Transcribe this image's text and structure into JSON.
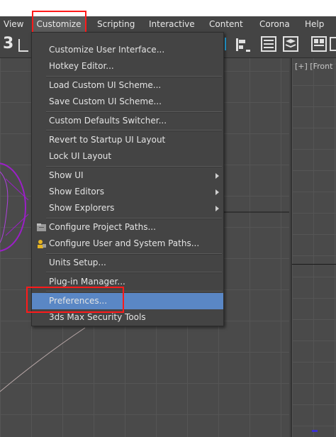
{
  "menubar": {
    "items": [
      "View",
      "Customize",
      "Scripting",
      "Interactive",
      "Content",
      "Corona",
      "Help"
    ]
  },
  "toolbar": {
    "snap_label": "3"
  },
  "viewport": {
    "right_label": "[+] [Front ]"
  },
  "customize_menu": {
    "items": [
      "Customize User Interface...",
      "Hotkey Editor...",
      "Load Custom UI Scheme...",
      "Save Custom UI Scheme...",
      "Custom Defaults Switcher...",
      "Revert to Startup UI Layout",
      "Lock UI Layout",
      "Show UI",
      "Show Editors",
      "Show Explorers",
      "Configure Project Paths...",
      "Configure User and System Paths...",
      "Units Setup...",
      "Plug-in Manager...",
      "Preferences...",
      "3ds Max Security Tools"
    ]
  },
  "colors": {
    "highlight_box": "#ff1a1a",
    "selected_item": "#5a87c5",
    "object_wireframe": "#9b1fc7"
  }
}
